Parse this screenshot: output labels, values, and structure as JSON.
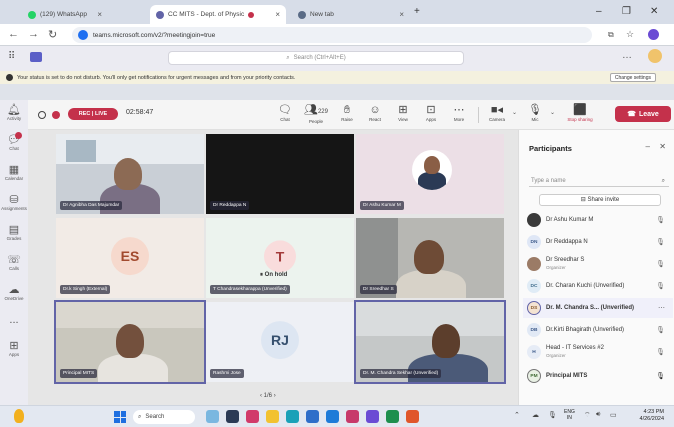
{
  "browser": {
    "tabs": [
      {
        "label": "(129) WhatsApp"
      },
      {
        "label": "CC MITS - Dept. of Physic",
        "active": true
      },
      {
        "label": "New tab"
      }
    ],
    "url": "teams.microsoft.com/v2/?meetingjoin=true"
  },
  "teams": {
    "search_placeholder": "Search (Ctrl+Alt+E)",
    "dnd_text": "Your status is set to do not disturb. You'll only get notifications for urgent messages and from your priority contacts.",
    "dnd_button": "Change settings"
  },
  "rail": [
    {
      "label": "Activity",
      "icon": "bell-icon"
    },
    {
      "label": "Chat",
      "icon": "chat-icon",
      "badge": true
    },
    {
      "label": "Calendar",
      "icon": "calendar-icon"
    },
    {
      "label": "Assignments",
      "icon": "assignment-icon"
    },
    {
      "label": "Grades",
      "icon": "grades-icon"
    },
    {
      "label": "Calls",
      "icon": "phone-icon"
    },
    {
      "label": "OneDrive",
      "icon": "cloud-icon"
    },
    {
      "label": "...",
      "icon": "more-icon"
    },
    {
      "label": "Apps",
      "icon": "apps-icon"
    }
  ],
  "meeting": {
    "rec_label": "REC | LIVE",
    "timer": "02:58:47",
    "toolbar": [
      {
        "label": "Chat",
        "icon": "chat-icon"
      },
      {
        "label": "People",
        "icon": "people-icon",
        "count": "229"
      },
      {
        "label": "Raise",
        "icon": "hand-icon"
      },
      {
        "label": "React",
        "icon": "smile-icon"
      },
      {
        "label": "View",
        "icon": "grid-icon"
      },
      {
        "label": "Apps",
        "icon": "plus-box-icon"
      },
      {
        "label": "More",
        "icon": "more-icon"
      },
      {
        "label": "Camera",
        "icon": "camera-icon"
      },
      {
        "label": "Mic",
        "icon": "mic-icon"
      },
      {
        "label": "Stop sharing",
        "icon": "share-stop-icon"
      }
    ],
    "leave_label": "Leave",
    "tiles": [
      {
        "name": "Dr Agnibha Das Majumdar",
        "type": "video"
      },
      {
        "name": "Dr Reddappa N",
        "type": "dark"
      },
      {
        "name": "Dr Ashu Kumar M",
        "type": "photo"
      },
      {
        "name": "Dr.k Singh (External)",
        "type": "initials",
        "initials": "ES",
        "color": "#f6d9cd",
        "fg": "#a24a2e"
      },
      {
        "name": "T Chandrasekharappa (Unverified)",
        "type": "initials",
        "initials": "T",
        "color": "#f9dcdc",
        "fg": "#a33a3a",
        "status": "On hold"
      },
      {
        "name": "Dr Sreedhar S",
        "type": "video"
      },
      {
        "name": "Principal MITS",
        "type": "video",
        "selected": true
      },
      {
        "name": "Rashmi Jose",
        "type": "initials",
        "initials": "RJ",
        "color": "#dde6f2",
        "fg": "#36506e"
      },
      {
        "name": "Dr. M. Chandra Sekhar (Unverified)",
        "type": "video",
        "selected": true
      }
    ],
    "pager": "1/6"
  },
  "participants": {
    "title": "Participants",
    "search_placeholder": "Type a name",
    "share_label": "Share invite",
    "list": [
      {
        "name": "Dr Ashu Kumar M",
        "initials": "",
        "color": "#3a3a3a"
      },
      {
        "name": "Dr Reddappa N",
        "initials": "DN",
        "color": "#dfe7f6"
      },
      {
        "name": "Dr Sreedhar S",
        "sub": "Organizer",
        "initials": "",
        "color": "#9b7b66"
      },
      {
        "name": "Dr. Charan Kuchi (Unverified)",
        "initials": "DC",
        "color": "#e0ecf6"
      },
      {
        "name": "Dr. M. Chandra S... (Unverified)",
        "initials": "DS",
        "color": "#f4e3d2",
        "highlight": true
      },
      {
        "name": "Dr.Kirti Bhagirath (Unverified)",
        "initials": "DB",
        "color": "#e1e9f5"
      },
      {
        "name": "Head - IT Services #2",
        "sub": "Organizer",
        "initials": "H",
        "color": "#e6ecf6"
      },
      {
        "name": "Principal MITS",
        "initials": "PM",
        "color": "#e8f0e4"
      }
    ]
  },
  "taskbar": {
    "search": "Search",
    "lang": "ENG",
    "region": "IN",
    "time": "4:23 PM",
    "date": "4/26/2024"
  }
}
